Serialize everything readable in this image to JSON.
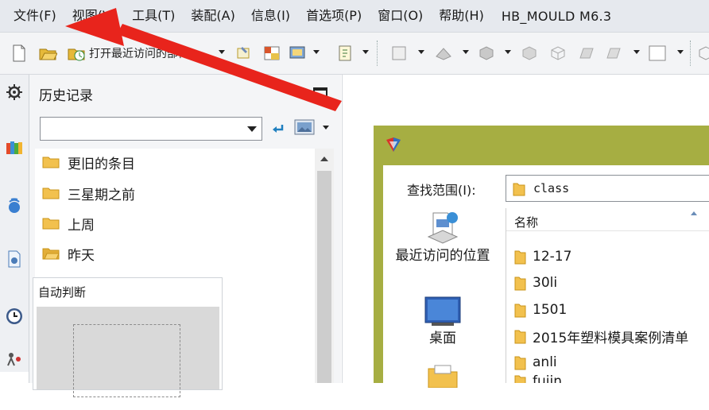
{
  "menubar": {
    "items": [
      {
        "label": "文件(F)"
      },
      {
        "label": "视图(V)"
      },
      {
        "label": "工具(T)"
      },
      {
        "label": "装配(A)"
      },
      {
        "label": "信息(I)"
      },
      {
        "label": "首选项(P)"
      },
      {
        "label": "窗口(O)"
      },
      {
        "label": "帮助(H)"
      }
    ],
    "app_title": "HB_MOULD M6.3"
  },
  "toolbar": {
    "open_recent_label": "打开最近访问的部件"
  },
  "history_panel": {
    "title": "历史记录",
    "path_value": "",
    "items": [
      {
        "label": "更旧的条目",
        "icon": "folder-icon"
      },
      {
        "label": "三星期之前",
        "icon": "folder-icon"
      },
      {
        "label": "上周",
        "icon": "folder-icon"
      },
      {
        "label": "昨天",
        "icon": "folder-open-icon"
      }
    ],
    "preview_title": "自动判断"
  },
  "open_dialog": {
    "look_in_label": "查找范围(I):",
    "look_in_value": "class",
    "places": [
      {
        "label": "最近访问的位置",
        "icon": "recent-places-icon"
      },
      {
        "label": "桌面",
        "icon": "desktop-icon"
      },
      {
        "label": "",
        "icon": "library-folder-icon"
      }
    ],
    "column_header": "名称",
    "files": [
      {
        "name": "12-17"
      },
      {
        "name": "30li"
      },
      {
        "name": "1501"
      },
      {
        "name": "2015年塑料模具案例清单"
      },
      {
        "name": "anli"
      },
      {
        "name": "fujin"
      }
    ]
  },
  "colors": {
    "menubar_bg": "#e6e9ee",
    "dialog_frame": "#a6ae42",
    "annotation_arrow": "#e8241c",
    "folder": "#f2c14e"
  }
}
